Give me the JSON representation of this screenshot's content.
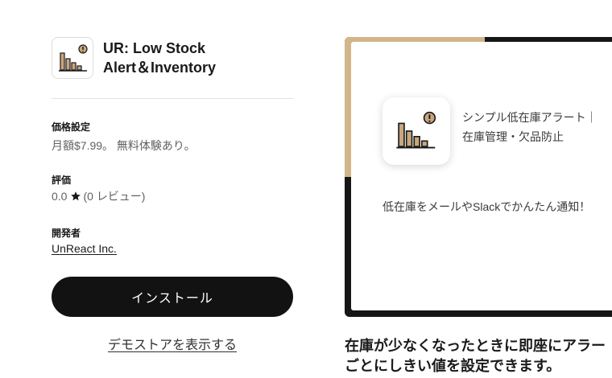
{
  "app": {
    "name_line1": "UR: Low Stock",
    "name_line2": "Alert＆Inventory",
    "icon": "bar-chart-alert-icon"
  },
  "pricing": {
    "label": "価格設定",
    "value": "月額$7.99。 無料体験あり。"
  },
  "rating": {
    "label": "評価",
    "score": "0.0",
    "icon": "star-icon",
    "reviews": "(0 レビュー)"
  },
  "developer": {
    "label": "開発者",
    "name": "UnReact Inc."
  },
  "actions": {
    "install": "インストール",
    "demo": "デモストアを表示する"
  },
  "preview": {
    "tagline_line1": "シンプル低在庫アラート｜",
    "tagline_line2": "在庫管理・欠品防止",
    "description": "低在庫をメールやSlackでかんたん通知！",
    "accent_color": "#d3b58a",
    "frame_color": "#161616"
  },
  "headline": {
    "line1": "在庫が少なくなったときに即座にアラー",
    "line2": "ごとにしきい値を設定できます。"
  }
}
